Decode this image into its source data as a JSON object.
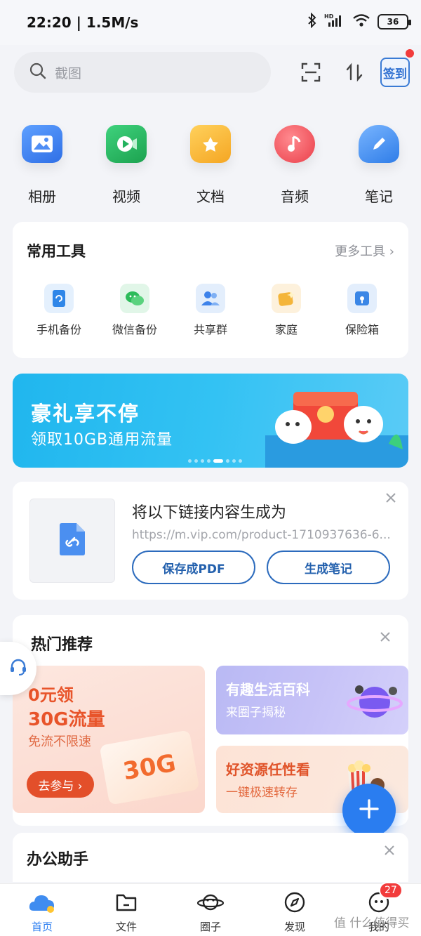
{
  "status": {
    "time": "22:20",
    "speed": "1.5M/s",
    "battery": "36"
  },
  "search": {
    "placeholder": "截图"
  },
  "signin": {
    "label": "签到"
  },
  "categories": [
    {
      "label": "相册",
      "icon": "album-icon",
      "color": "#3d7ff0"
    },
    {
      "label": "视频",
      "icon": "video-icon",
      "color": "#22b463"
    },
    {
      "label": "文档",
      "icon": "document-folder-icon",
      "color": "#f7b734"
    },
    {
      "label": "音频",
      "icon": "music-note-icon",
      "color": "#f2525a"
    },
    {
      "label": "笔记",
      "icon": "cloud-pen-icon",
      "color": "#3b8bef"
    }
  ],
  "tools": {
    "title": "常用工具",
    "more": "更多工具 ›",
    "items": [
      {
        "label": "手机备份",
        "icon": "phone-backup-icon",
        "color": "#2f86e8"
      },
      {
        "label": "微信备份",
        "icon": "wechat-backup-icon",
        "color": "#2dbb5a"
      },
      {
        "label": "共享群",
        "icon": "shared-group-icon",
        "color": "#3d82ea"
      },
      {
        "label": "家庭",
        "icon": "family-icon",
        "color": "#f4b53a"
      },
      {
        "label": "保险箱",
        "icon": "safe-box-icon",
        "color": "#3a86e6"
      }
    ]
  },
  "banner": {
    "title": "豪礼享不停",
    "subtitle": "领取10GB通用流量"
  },
  "link_card": {
    "title": "将以下链接内容生成为",
    "url": "https://m.vip.com/product-1710937636-6...",
    "save_pdf": "保存成PDF",
    "gen_note": "生成笔记"
  },
  "hot": {
    "title": "热门推荐",
    "left": {
      "line1": "0元领",
      "line2": "30G流量",
      "line3": "免流不限速",
      "button": "去参与 ›",
      "gift_text": "30G"
    },
    "right_top": {
      "title": "有趣生活百科",
      "subtitle": "来圈子揭秘"
    },
    "right_bottom": {
      "title": "好资源任性看",
      "subtitle": "一键极速转存"
    }
  },
  "office": {
    "title": "办公助手"
  },
  "nav": {
    "items": [
      {
        "label": "首页",
        "icon": "home-cloud-icon"
      },
      {
        "label": "文件",
        "icon": "folder-icon"
      },
      {
        "label": "圈子",
        "icon": "planet-icon"
      },
      {
        "label": "发现",
        "icon": "compass-icon"
      },
      {
        "label": "我的",
        "icon": "profile-face-icon"
      }
    ],
    "badge": "27"
  },
  "watermark": "值 什么值得买"
}
